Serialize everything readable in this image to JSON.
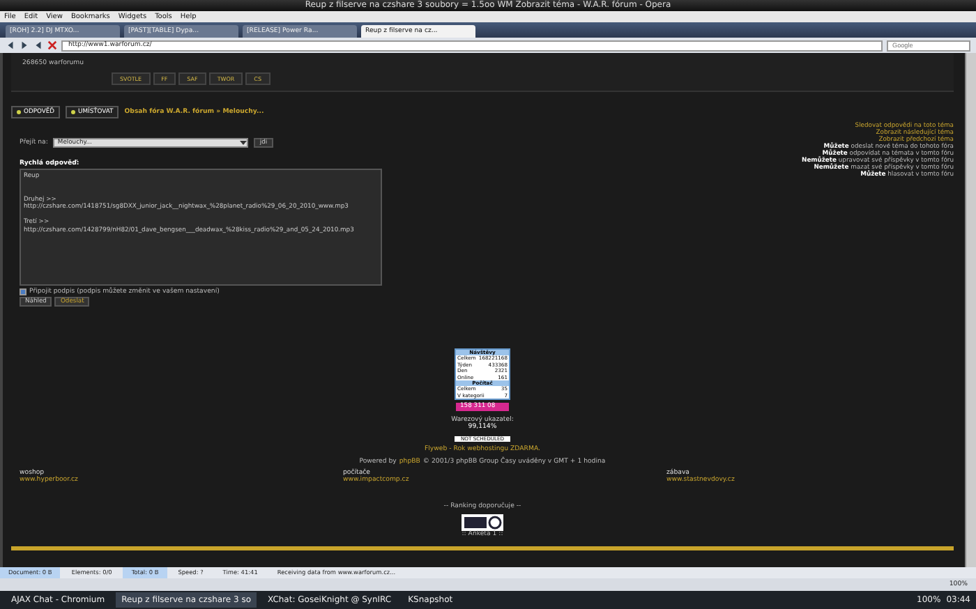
{
  "window": {
    "title": "Reup z filserve na czshare 3 soubory = 1.5oo WM Zobrazit téma - W.A.R. fórum - Opera"
  },
  "menu": [
    "File",
    "Edit",
    "View",
    "Bookmarks",
    "Widgets",
    "Tools",
    "Help"
  ],
  "tabs": [
    {
      "label": "[ROH] 2.2] DJ MTXO...",
      "selected": false
    },
    {
      "label": "[PAST][TABLE] Dypa...",
      "selected": false
    },
    {
      "label": "[RELEASE] Power Ra...",
      "selected": false
    },
    {
      "label": "Reup z filserve na cz...",
      "selected": true
    }
  ],
  "address_bar": {
    "url": "http://www1.warforum.cz/",
    "search_placeholder": "Google"
  },
  "forum": {
    "nav_info": "268650 warforumu",
    "nav_buttons": [
      "SVOTLE",
      "FF",
      "SAF",
      "TWOR",
      "CS"
    ],
    "actions": [
      "ODPOVĚĎ",
      "UMÍSŤOVAT"
    ],
    "breadcrumb": "Obsah fóra W.A.R. fórum » Melouchy...",
    "jump": {
      "label": "Přejít na:",
      "value": "Melouchy...",
      "button": "jdi"
    },
    "permissions": [
      {
        "kind": "link",
        "text": "Sledovat odpovědi na toto téma"
      },
      {
        "kind": "link",
        "text": "Zobrazit následující téma"
      },
      {
        "kind": "link",
        "text": "Zobrazit předchozí téma"
      },
      {
        "kind": "info",
        "text": "**Můžete** odeslat nové téma do tohoto fóra"
      },
      {
        "kind": "info",
        "text": "**Můžete** odpovídat na témata v tomto fóru"
      },
      {
        "kind": "info",
        "text": "**Nemůžete** upravovat své příspěvky v tomto fóru"
      },
      {
        "kind": "info",
        "text": "**Nemůžete** mazat své příspěvky v tomto fóru"
      },
      {
        "kind": "info",
        "text": "**Můžete** hlasovat v tomto fóru"
      }
    ],
    "quick_reply": {
      "title": "Rychlá odpověď:",
      "text": "Reup\n\n\nDruhej >>    http://czshare.com/1418751/sg8DXX_junior_jack__nightwax_%28planet_radio%29_06_20_2010_www.mp3\n\nTretí >>    http://czshare.com/1428799/nH82/01_dave_bengsen___deadwax_%28kiss_radio%29_and_05_24_2010.mp3",
      "signature": {
        "label": "Připojit podpis (podpis můžete změnit ve vašem nastavení)",
        "checked": true
      },
      "buttons": [
        "Náhled",
        "Odeslat"
      ]
    }
  },
  "counter": {
    "sections": [
      {
        "title": "Návštěvy",
        "rows": [
          {
            "label": "Celkem",
            "value": "168221168"
          },
          {
            "label": "Týden",
            "value": "433368"
          },
          {
            "label": "Den",
            "value": "2321"
          },
          {
            "label": "Online",
            "value": "161"
          }
        ]
      },
      {
        "title": "Počítač",
        "rows": [
          {
            "label": "Celkem",
            "value": "35"
          },
          {
            "label": "V kategorii",
            "value": "7"
          }
        ]
      }
    ],
    "badge": "158 311 08",
    "rating_label": "Warezový ukazatel:",
    "rating": "99,114%",
    "banner": "NOT SCHEDULED"
  },
  "footer": {
    "promo": "Flyweb - Rok webhostingu ZDARMA.",
    "powered_link": "phpBB",
    "powered_before": "Powered by",
    "powered_after": "© 2001/3 phpBB Group Časy uváděny v GMT + 1 hodina",
    "columns": [
      {
        "title": "woshop",
        "link": "www.hyperboor.cz"
      },
      {
        "title": "počítače",
        "link": "www.impactcomp.cz"
      },
      {
        "title": "zábava",
        "link": "www.stastnevdovy.cz"
      }
    ],
    "ranking": "-- Ranking doporučuje --",
    "poll": ":: Anketa 1 ::"
  },
  "status_bar": [
    {
      "text": "Document: 0 B",
      "selected": true
    },
    {
      "text": "Elements: 0/0",
      "selected": false
    },
    {
      "text": "Total: 0 B",
      "selected": true
    },
    {
      "text": "Speed: ?",
      "selected": false
    },
    {
      "text": "Time: 41:41",
      "selected": false
    },
    {
      "text": "Receiving data from www.warforum.cz...",
      "selected": false
    }
  ],
  "zoom": "100%",
  "taskbar": {
    "tasks": [
      {
        "label": "AJAX Chat - Chromium",
        "selected": false
      },
      {
        "label": "Reup z filserve na czshare 3 so",
        "selected": true
      },
      {
        "label": "XChat: GoseiKnight @ SynIRC",
        "selected": false
      },
      {
        "label": "KSnapshot",
        "selected": false
      }
    ],
    "battery": "100%",
    "clock": "03:44"
  }
}
